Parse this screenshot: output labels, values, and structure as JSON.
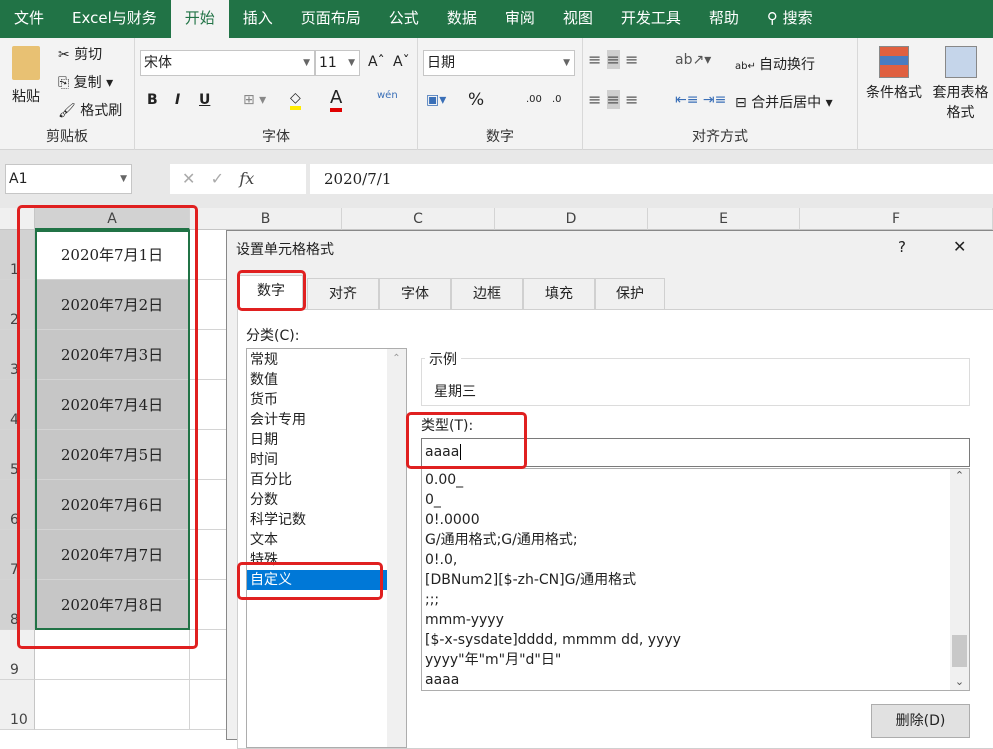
{
  "tabs": [
    "文件",
    "Excel与财务",
    "开始",
    "插入",
    "页面布局",
    "公式",
    "数据",
    "审阅",
    "视图",
    "开发工具",
    "帮助",
    "搜索"
  ],
  "ribbon": {
    "clipboard": {
      "paste": "粘贴",
      "cut": "剪切",
      "copy": "复制",
      "painter": "格式刷",
      "label": "剪贴板"
    },
    "font": {
      "name": "宋体",
      "size": "11",
      "label": "字体",
      "bold": "B",
      "italic": "I",
      "underline": "U",
      "wen": "wén"
    },
    "number": {
      "format": "日期",
      "label": "数字",
      "percent": "%",
      "inc": ".00",
      "dec": ".0"
    },
    "align": {
      "wrap": "自动换行",
      "merge": "合并后居中",
      "label": "对齐方式"
    },
    "styles": {
      "cond": "条件格式",
      "table": "套用表格格式"
    }
  },
  "formula": {
    "namebox": "A1",
    "fx": "fx",
    "value": "2020/7/1"
  },
  "columns": [
    "A",
    "B",
    "C",
    "D",
    "E",
    "F"
  ],
  "rows": [
    "1",
    "2",
    "3",
    "4",
    "5",
    "6",
    "7",
    "8",
    "9",
    "10"
  ],
  "cells": [
    "2020年7月1日",
    "2020年7月2日",
    "2020年7月3日",
    "2020年7月4日",
    "2020年7月5日",
    "2020年7月6日",
    "2020年7月7日",
    "2020年7月8日"
  ],
  "dialog": {
    "title": "设置单元格格式",
    "help": "?",
    "close": "✕",
    "tabs": [
      "数字",
      "对齐",
      "字体",
      "边框",
      "填充",
      "保护"
    ],
    "category_label": "分类(C):",
    "categories": [
      "常规",
      "数值",
      "货币",
      "会计专用",
      "日期",
      "时间",
      "百分比",
      "分数",
      "科学记数",
      "文本",
      "特殊",
      "自定义"
    ],
    "sample_label": "示例",
    "sample_value": "星期三",
    "type_label": "类型(T):",
    "type_value": "aaaa",
    "formats": [
      "0.00_",
      "0_",
      "0!.0000",
      "G/通用格式;G/通用格式;",
      "0!.0,",
      "[DBNum2][$-zh-CN]G/通用格式",
      ";;;",
      "mmm-yyyy",
      "[$-x-sysdate]dddd, mmmm dd, yyyy",
      "yyyy\"年\"m\"月\"d\"日\"",
      "aaaa"
    ],
    "delete": "删除(D)"
  },
  "colors": {
    "green": "#217346",
    "highlight": "#e02020",
    "select": "#0078d7"
  }
}
